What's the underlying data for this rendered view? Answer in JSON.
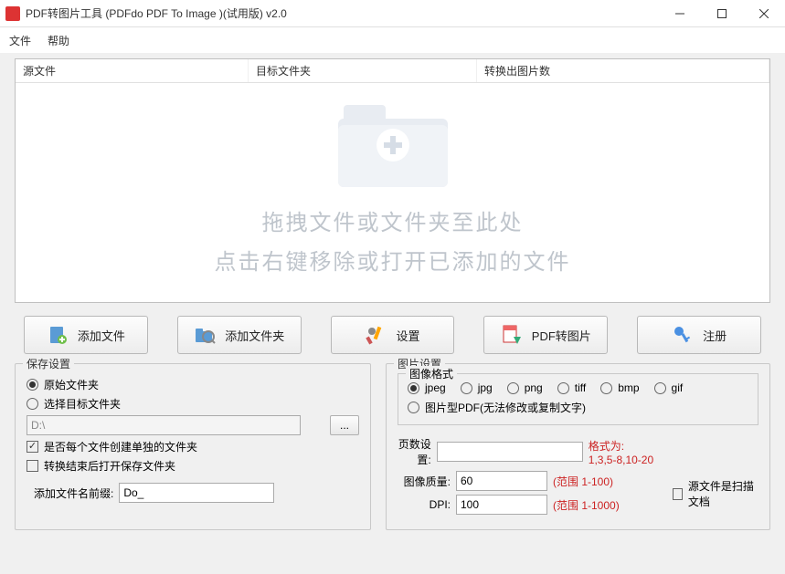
{
  "title": "PDF转图片工具 (PDFdo PDF To Image )(试用版) v2.0",
  "menu": {
    "file": "文件",
    "help": "帮助"
  },
  "columns": {
    "source": "源文件",
    "target": "目标文件夹",
    "count": "转换出图片数"
  },
  "drop": {
    "line1": "拖拽文件或文件夹至此处",
    "line2": "点击右键移除或打开已添加的文件"
  },
  "buttons": {
    "addFile": "添加文件",
    "addFolder": "添加文件夹",
    "settings": "设置",
    "convert": "PDF转图片",
    "register": "注册"
  },
  "save": {
    "legend": "保存设置",
    "orig": "原始文件夹",
    "choose": "选择目标文件夹",
    "path": "D:\\",
    "browse": "...",
    "perFile": "是否每个文件创建单独的文件夹",
    "openAfter": "转换结束后打开保存文件夹",
    "prefixLabel": "添加文件名前缀:",
    "prefix": "Do_"
  },
  "img": {
    "legend": "图片设置",
    "formatLegend": "图像格式",
    "formats": {
      "jpeg": "jpeg",
      "jpg": "jpg",
      "png": "png",
      "tiff": "tiff",
      "bmp": "bmp",
      "gif": "gif"
    },
    "pdfImage": "图片型PDF(无法修改或复制文字)",
    "pagesLabel": "页数设置:",
    "pagesValue": "",
    "pagesHint": "格式为: 1,3,5-8,10-20",
    "qualityLabel": "图像质量:",
    "qualityValue": "60",
    "qualityHint": "(范围 1-100)",
    "dpiLabel": "DPI:",
    "dpiValue": "100",
    "dpiHint": "(范围 1-1000)",
    "scanDoc": "源文件是扫描文档"
  }
}
